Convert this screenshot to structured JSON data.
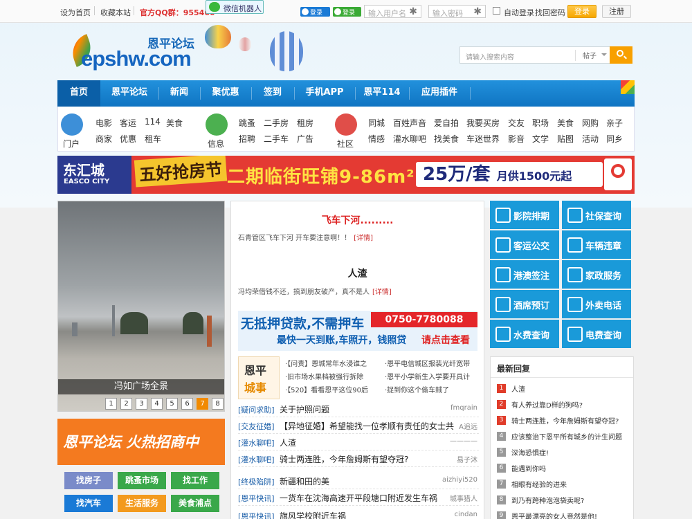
{
  "topbar": {
    "set_home": "设为首页",
    "bookmark": "收藏本站",
    "qq_group": "官方QQ群：955460",
    "wechat_bot": "微信机器人",
    "qq_login": "登录",
    "wx_login": "登录",
    "username_placeholder": "输入用户名",
    "password_placeholder": "输入密码",
    "auto_login": "自动登录",
    "find_password": "找回密码",
    "login": "登录",
    "register": "注册"
  },
  "header": {
    "logo_cn": "恩平论坛",
    "logo_en": "epshw.com",
    "search_placeholder": "请输入搜索内容",
    "search_category": "帖子"
  },
  "nav": [
    "首页",
    "恩平论坛",
    "新闻",
    "聚优惠",
    "签到",
    "手机APP",
    "恩平114",
    "应用插件"
  ],
  "categories": {
    "portal": {
      "label": "门户",
      "links": [
        "电影",
        "客运",
        "114",
        "美食",
        "商家",
        "优惠",
        "租车"
      ]
    },
    "info": {
      "label": "信息",
      "links": [
        "跳蚤",
        "二手房",
        "租房",
        "招聘",
        "二手车",
        "广告"
      ]
    },
    "community": {
      "label": "社区",
      "links": [
        "同城",
        "百姓声音",
        "爱自拍",
        "我要买房",
        "交友",
        "职场",
        "美食",
        "网购",
        "亲子",
        "情感",
        "灌水聊吧",
        "找美食",
        "车迷世界",
        "影音",
        "文学",
        "贴图",
        "活动",
        "同乡"
      ]
    }
  },
  "banner": {
    "brand_cn": "东汇城",
    "brand_en": "EASCO CITY",
    "event": "五好抢房节",
    "headline": "二期临街旺铺9-86m²",
    "price": "25万/套",
    "monthly": "月供1500元起"
  },
  "slideshow": {
    "caption": "冯如广场全景",
    "pages": [
      "1",
      "2",
      "3",
      "4",
      "5",
      "6",
      "7",
      "8"
    ],
    "current_page": 7
  },
  "promo": "恩平论坛 火热招商中",
  "left_tags": [
    {
      "label": "找房子",
      "color": "#7a8bc9"
    },
    {
      "label": "跳蚤市场",
      "color": "#3aa84a"
    },
    {
      "label": "找工作",
      "color": "#3aa84a"
    },
    {
      "label": "找汽车",
      "color": "#1a7ad6"
    },
    {
      "label": "生活服务",
      "color": "#f39a1e"
    },
    {
      "label": "美食浦点",
      "color": "#3aa84a"
    }
  ],
  "headlines": [
    {
      "title": "飞车下河.........",
      "summary": "石青管区飞车下河 开车要注意啊！！",
      "more": "[详情]"
    },
    {
      "title": "人渣",
      "summary": "冯均荣借钱不还，搞到朋友破产，真不是人",
      "more": "[详情]"
    }
  ],
  "mid_ad": {
    "line1": "无抵押贷款,不需押车",
    "phone": "0750-7780088",
    "line2": "最快一天到账,车照开，钱照贷",
    "cta": "请点击查看"
  },
  "enping_city": {
    "label1": "恩平",
    "label2": "城事",
    "news": [
      "·【问责】恩城常年水浸谁之",
      "·恩平电信城区报装光纤宽带",
      "·旧市场水果档被强行拆除",
      "·恩平小学新生入学要开具计",
      "·【520】看看恩平这位90后",
      "·捉到你这个偷车贼了"
    ]
  },
  "threads": [
    {
      "category": "[疑问求助]",
      "title": "关于护照问题",
      "user": "fmqrain"
    },
    {
      "category": "[交友征婚]",
      "title": "【异地征婚】希望能找一位孝顺有责任的女士共",
      "user": "A追远"
    },
    {
      "category": "[灌水聊吧]",
      "title": "人渣",
      "user": "————"
    },
    {
      "category": "[灌水聊吧]",
      "title": "骑士两连胜，今年詹姆斯有望夺冠?",
      "user": "易子沐"
    },
    {
      "category": "[终极陷阱]",
      "title": "新疆和田的美",
      "user": "aizhiyi520"
    },
    {
      "category": "[恩平快讯]",
      "title": "一货车在沈海高速开平段塘口附近发生车祸",
      "user": "城事猎人"
    },
    {
      "category": "[恩平快讯]",
      "title": "旗风学校附近车祸",
      "user": "cindan"
    }
  ],
  "services": [
    {
      "label": "影院排期",
      "icon": "film-icon"
    },
    {
      "label": "社保查询",
      "icon": "receipt-icon"
    },
    {
      "label": "客运公交",
      "icon": "bus-icon"
    },
    {
      "label": "车辆违章",
      "icon": "id-card-icon"
    },
    {
      "label": "港澳签注",
      "icon": "ship-icon"
    },
    {
      "label": "家政服务",
      "icon": "iron-icon"
    },
    {
      "label": "酒席预订",
      "icon": "wine-icon"
    },
    {
      "label": "外卖电话",
      "icon": "cup-icon"
    },
    {
      "label": "水费查询",
      "icon": "drop-icon"
    },
    {
      "label": "电费查询",
      "icon": "lightning-icon"
    }
  ],
  "latest_replies": {
    "title": "最新回复",
    "items": [
      {
        "num": "1",
        "title": "人渣"
      },
      {
        "num": "2",
        "title": "有人养过靠D样的狗吗?"
      },
      {
        "num": "3",
        "title": "骑士两连胜，今年詹姆斯有望夺冠?"
      },
      {
        "num": "4",
        "title": "应该整治下恩平所有城乡的计生问题"
      },
      {
        "num": "5",
        "title": "深海恐惧症!"
      },
      {
        "num": "6",
        "title": "能遇到你吗"
      },
      {
        "num": "7",
        "title": "相眼有经验的进来"
      },
      {
        "num": "8",
        "title": "到乃有跨种泡泡袋卖呢?"
      },
      {
        "num": "9",
        "title": "恩平最漂亮的女人竟然是他!"
      }
    ]
  },
  "colors": {
    "nav_blue": "#1583d0",
    "accent_orange": "#f7a700",
    "service_blue": "#1a9ad9",
    "banner_red": "#e43a33"
  }
}
